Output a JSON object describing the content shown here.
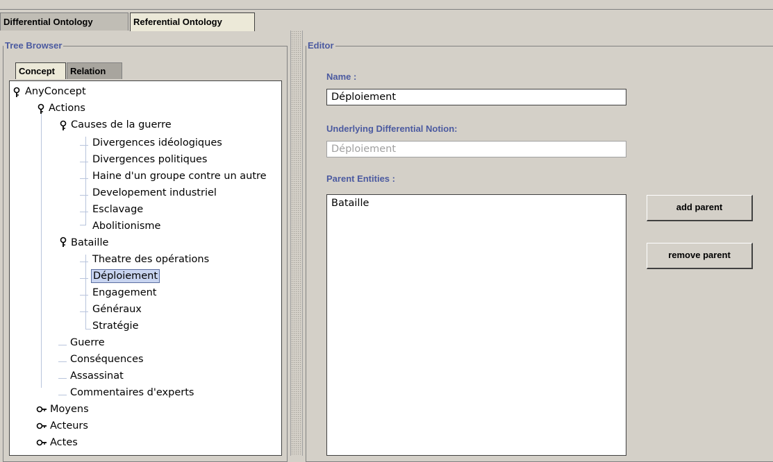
{
  "tabs": {
    "differential": "Differential Ontology",
    "referential": "Referential Ontology"
  },
  "tree_browser": {
    "title": "Tree Browser",
    "subtabs": {
      "concept": "Concept",
      "relation": "Relation"
    },
    "nodes": [
      "AnyConcept",
      "Actions",
      "Causes de la guerre",
      "Divergences idéologiques",
      "Divergences politiques",
      "Haine d'un groupe contre un autre",
      "Developement industriel",
      "Esclavage",
      "Abolitionisme",
      "Bataille",
      "Theatre des opérations",
      "Déploiement",
      "Engagement",
      "Généraux",
      "Stratégie",
      "Guerre",
      "Conséquences",
      "Assassinat",
      "Commentaires d'experts",
      "Moyens",
      "Acteurs",
      "Actes"
    ],
    "selected": "Déploiement"
  },
  "editor": {
    "title": "Editor",
    "name_label": "Name :",
    "name_value": "Déploiement",
    "underlying_label": "Underlying Differential Notion:",
    "underlying_value": "Déploiement",
    "parents_label": "Parent Entities :",
    "parents": [
      "Bataille"
    ],
    "add_parent": "add parent",
    "remove_parent": "remove parent"
  },
  "colors": {
    "panel_bg": "#d4d0c8",
    "label_blue": "#4b5aa0",
    "selection": "#c8d4f0"
  }
}
